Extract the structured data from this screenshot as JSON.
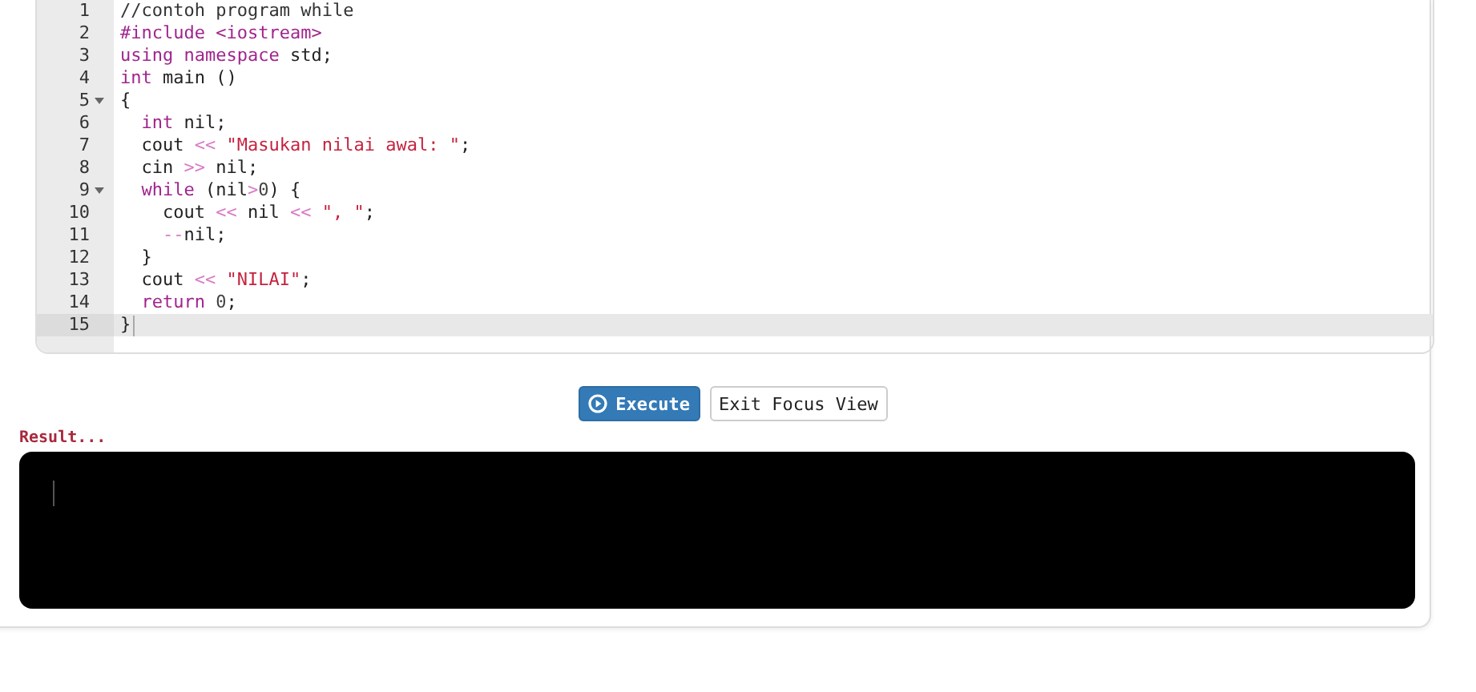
{
  "editor": {
    "lines": [
      {
        "number": "1",
        "foldable": false,
        "active": false,
        "tokens": [
          {
            "kind": "comment",
            "text": "//contoh program while"
          }
        ]
      },
      {
        "number": "2",
        "foldable": false,
        "active": false,
        "tokens": [
          {
            "kind": "meta",
            "text": "#include <iostream>"
          }
        ]
      },
      {
        "number": "3",
        "foldable": false,
        "active": false,
        "tokens": [
          {
            "kind": "keyword",
            "text": "using"
          },
          {
            "kind": "keyword",
            "text": " namespace"
          },
          {
            "kind": "plain",
            "text": " std;"
          }
        ]
      },
      {
        "number": "4",
        "foldable": false,
        "active": false,
        "tokens": [
          {
            "kind": "keyword",
            "text": "int"
          },
          {
            "kind": "plain",
            "text": " main ()"
          }
        ]
      },
      {
        "number": "5",
        "foldable": true,
        "active": false,
        "tokens": [
          {
            "kind": "bracket",
            "text": "{"
          }
        ]
      },
      {
        "number": "6",
        "foldable": false,
        "active": false,
        "tokens": [
          {
            "kind": "keyword",
            "text": "  int"
          },
          {
            "kind": "plain",
            "text": " nil;"
          }
        ]
      },
      {
        "number": "7",
        "foldable": false,
        "active": false,
        "tokens": [
          {
            "kind": "plain",
            "text": "  cout"
          },
          {
            "kind": "operator",
            "text": " <<"
          },
          {
            "kind": "string",
            "text": " \"Masukan nilai awal: \""
          },
          {
            "kind": "plain",
            "text": ";"
          }
        ]
      },
      {
        "number": "8",
        "foldable": false,
        "active": false,
        "tokens": [
          {
            "kind": "plain",
            "text": "  cin"
          },
          {
            "kind": "operator",
            "text": " >>"
          },
          {
            "kind": "plain",
            "text": " nil;"
          }
        ]
      },
      {
        "number": "9",
        "foldable": true,
        "active": false,
        "tokens": [
          {
            "kind": "keyword",
            "text": "  while"
          },
          {
            "kind": "plain",
            "text": " (nil"
          },
          {
            "kind": "operator",
            "text": ">"
          },
          {
            "kind": "number",
            "text": "0"
          },
          {
            "kind": "plain",
            "text": ") {"
          }
        ]
      },
      {
        "number": "10",
        "foldable": false,
        "active": false,
        "tokens": [
          {
            "kind": "plain",
            "text": "    cout"
          },
          {
            "kind": "operator",
            "text": " <<"
          },
          {
            "kind": "plain",
            "text": " nil"
          },
          {
            "kind": "operator",
            "text": " <<"
          },
          {
            "kind": "string",
            "text": " \", \""
          },
          {
            "kind": "plain",
            "text": ";"
          }
        ]
      },
      {
        "number": "11",
        "foldable": false,
        "active": false,
        "tokens": [
          {
            "kind": "operator",
            "text": "    --"
          },
          {
            "kind": "plain",
            "text": "nil;"
          }
        ]
      },
      {
        "number": "12",
        "foldable": false,
        "active": false,
        "tokens": [
          {
            "kind": "plain",
            "text": "  }"
          }
        ]
      },
      {
        "number": "13",
        "foldable": false,
        "active": false,
        "tokens": [
          {
            "kind": "plain",
            "text": "  cout"
          },
          {
            "kind": "operator",
            "text": " <<"
          },
          {
            "kind": "string",
            "text": " \"NILAI\""
          },
          {
            "kind": "plain",
            "text": ";"
          }
        ]
      },
      {
        "number": "14",
        "foldable": false,
        "active": false,
        "tokens": [
          {
            "kind": "keyword",
            "text": "  return"
          },
          {
            "kind": "number",
            "text": " 0"
          },
          {
            "kind": "plain",
            "text": ";"
          }
        ]
      },
      {
        "number": "15",
        "foldable": false,
        "active": true,
        "tokens": [
          {
            "kind": "bracket",
            "text": "}"
          }
        ]
      }
    ]
  },
  "buttons": {
    "execute": "Execute",
    "exit_focus": "Exit Focus View"
  },
  "result": {
    "label": "Result..."
  }
}
